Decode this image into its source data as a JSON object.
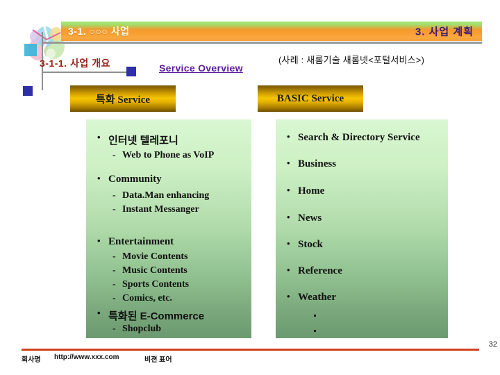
{
  "header": {
    "left_title": "3-1. ○○○ 사업",
    "right_title": "3. 사업 계획",
    "left_title_color": "#fdfdf0",
    "right_title_color": "#3c1a7a",
    "bar_gradient_from": "#a8e878",
    "bar_gradient_to": "#f6a03a"
  },
  "subheader": {
    "section_title": "3-1-1. 사업 개요",
    "section_title_color": "#9c2015",
    "overview_link": "Service Overview",
    "overview_link_color": "#5b1a9e",
    "case_note": "(사례 : 새롬기술 새롬넷<포털서비스>)"
  },
  "columns": {
    "left": {
      "box_label": "특화 Service",
      "box_gradient_mid": "#f5c400",
      "panel_gradient_from": "#d9f7d2",
      "panel_gradient_to": "#6c9a70",
      "items": [
        {
          "text": "인터넷 텔레포니",
          "level": 1,
          "script": "kr"
        },
        {
          "text": "Web to Phone as VoIP",
          "level": 2
        },
        {
          "text": "Community",
          "level": 1
        },
        {
          "text": "Data.Man enhancing",
          "level": 2
        },
        {
          "text": "Instant Messanger",
          "level": 2
        },
        {
          "text": "Entertainment",
          "level": 1
        },
        {
          "text": "Movie Contents",
          "level": 2
        },
        {
          "text": "Music Contents",
          "level": 2
        },
        {
          "text": "Sports Contents",
          "level": 2
        },
        {
          "text": "Comics, etc.",
          "level": 2
        },
        {
          "text": "특화된 E-Commerce",
          "level": 1,
          "script": "kr"
        },
        {
          "text": "Shopclub",
          "level": 2
        }
      ]
    },
    "right": {
      "box_label": "BASIC Service",
      "box_gradient_mid": "#f5c400",
      "panel_gradient_from": "#d9f7d2",
      "panel_gradient_to": "#6c9a70",
      "items": [
        {
          "text": "Search & Directory Service",
          "level": 1
        },
        {
          "text": "Business",
          "level": 1
        },
        {
          "text": "Home",
          "level": 1
        },
        {
          "text": "News",
          "level": 1
        },
        {
          "text": "Stock",
          "level": 1
        },
        {
          "text": "Reference",
          "level": 1
        },
        {
          "text": "Weather",
          "level": 1
        }
      ],
      "trailing_dots": 2
    }
  },
  "footer": {
    "company": "회사명",
    "url": "http://www.xxx.com",
    "slogan": "비젼 표어",
    "rule_color": "#d1401e",
    "page_number": "32"
  }
}
